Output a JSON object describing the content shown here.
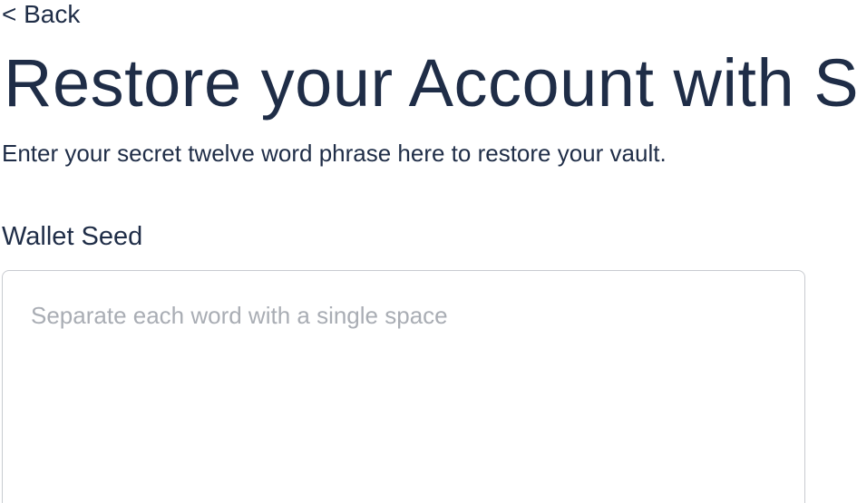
{
  "nav": {
    "back_label": "< Back"
  },
  "header": {
    "title": "Restore your Account with Se",
    "subtitle": "Enter your secret twelve word phrase here to restore your vault."
  },
  "form": {
    "seed_label": "Wallet Seed",
    "seed_value": "",
    "seed_placeholder": "Separate each word with a single space"
  },
  "colors": {
    "text": "#1f2d47",
    "placeholder": "#a9adb4",
    "border": "#c8cbd0",
    "background": "#ffffff"
  }
}
